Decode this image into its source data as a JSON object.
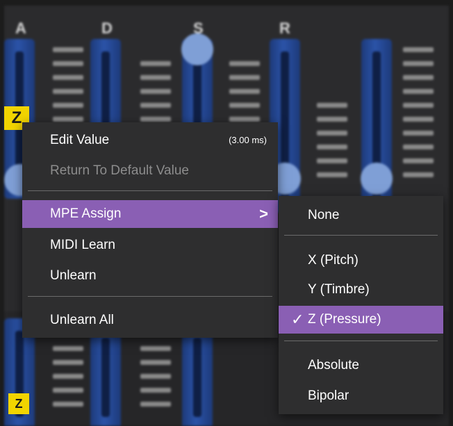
{
  "background_panel": {
    "column_letters": [
      "A",
      "D",
      "S",
      "R"
    ],
    "mpe_badge_top": "Z",
    "mpe_badge_bottom": "Z"
  },
  "context_menu": {
    "items": [
      {
        "label": "Edit Value",
        "value": "(3.00 ms)",
        "enabled": true
      },
      {
        "label": "Return To Default Value",
        "enabled": false
      },
      {
        "label": "MPE Assign",
        "has_submenu": true,
        "highlighted": true,
        "arrow": ">"
      },
      {
        "label": "MIDI Learn",
        "enabled": true
      },
      {
        "label": "Unlearn",
        "enabled": true
      },
      {
        "label": "Unlearn All",
        "enabled": true
      }
    ]
  },
  "mpe_submenu": {
    "items": [
      {
        "label": "None"
      },
      {
        "label": "X (Pitch)"
      },
      {
        "label": "Y (Timbre)"
      },
      {
        "label": "Z (Pressure)",
        "checked": true,
        "highlighted": true,
        "check": "✓"
      },
      {
        "label": "Absolute"
      },
      {
        "label": "Bipolar"
      }
    ]
  },
  "colors": {
    "highlight": "#8a5fb4",
    "menu_bg": "#2e2e2f",
    "badge": "#f2d400",
    "slider": "#2b53a8"
  }
}
